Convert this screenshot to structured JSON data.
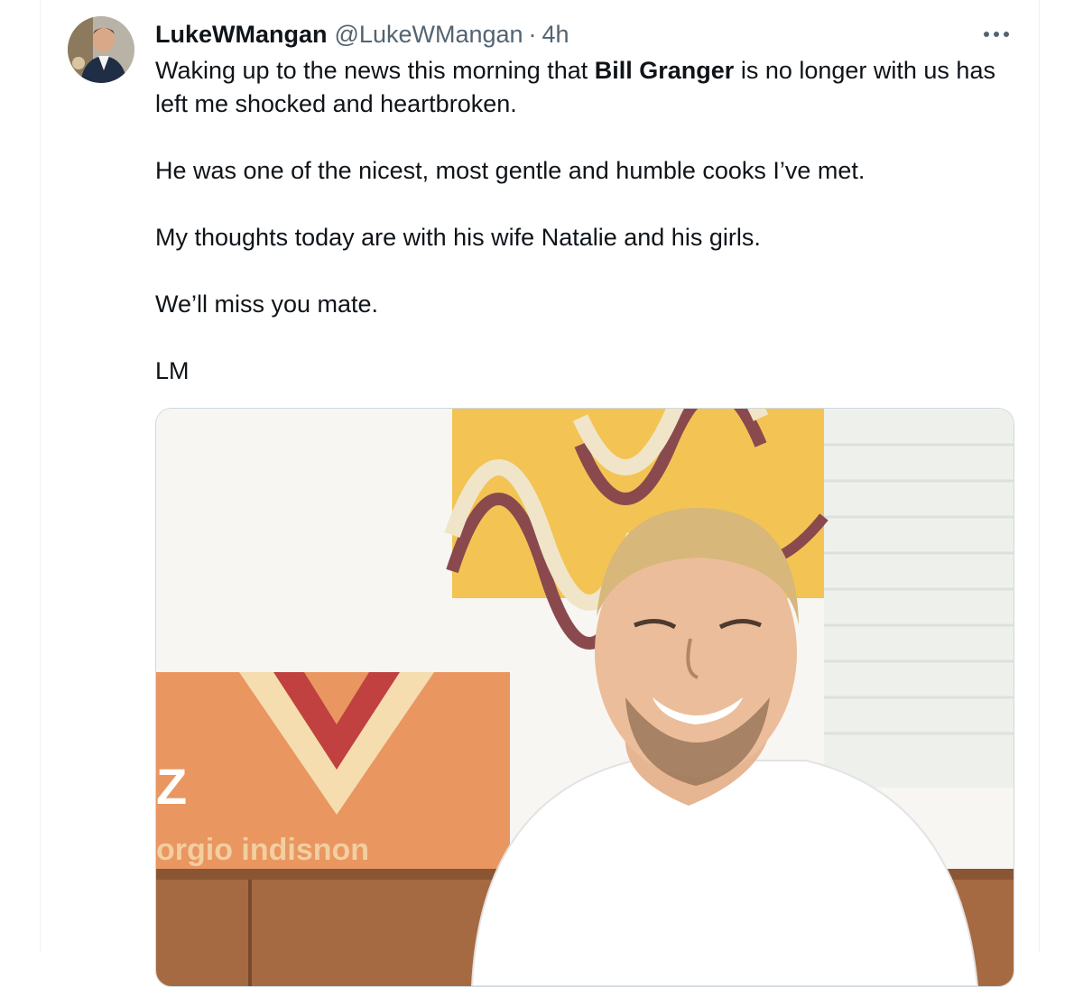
{
  "tweet": {
    "author_name": "LukeWMangan",
    "author_handle": "@LukeWMangan",
    "separator": "·",
    "time": "4h",
    "text": {
      "line1_pre": "Waking up to the news this morning that ",
      "mention": "Bill Granger",
      "line1_post": " is no longer with us has left me shocked and heartbroken.",
      "para2": "He was one of the nicest, most gentle and humble cooks I’ve met.",
      "para3": "My thoughts today are with his wife Natalie and his girls.",
      "para4": "We’ll miss you mate.",
      "para5": "LM"
    },
    "media": {
      "sign_text": "orgio indisnon",
      "sign_letter": "Z"
    }
  },
  "icons": {
    "avatar": "profile-photo",
    "more": "more-horizontal-icon"
  },
  "colors": {
    "text": "#0f1419",
    "secondary": "#536471",
    "border": "#cfd9de"
  }
}
